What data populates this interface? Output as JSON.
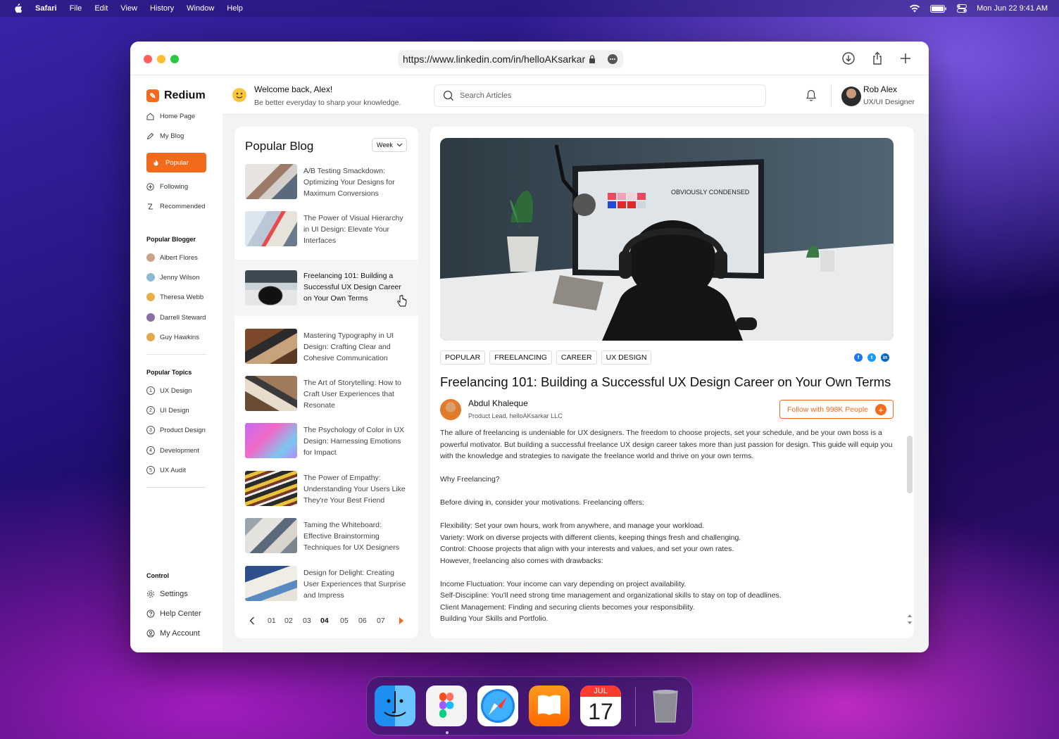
{
  "menubar": {
    "items": [
      "Safari",
      "File",
      "Edit",
      "View",
      "History",
      "Window",
      "Help"
    ],
    "datetime": "Mon Jun 22  9:41 AM"
  },
  "browser": {
    "url": "https://www.linkedin.com/in/helloAKsarkar"
  },
  "app": {
    "name": "Redium",
    "accent": "#f26b1d"
  },
  "sidebar": {
    "nav": [
      {
        "label": "Home Page",
        "icon": "home-icon"
      },
      {
        "label": "My Blog",
        "icon": "pen-icon"
      },
      {
        "label": "Popular",
        "icon": "fire-icon",
        "active": true
      },
      {
        "label": "Following",
        "icon": "plus-circle-icon"
      },
      {
        "label": "Recommended",
        "icon": "recommend-icon"
      }
    ],
    "bloggers_title": "Popular Blogger",
    "bloggers": [
      "Albert Flores",
      "Jenny Wilson",
      "Theresa Webb",
      "Darrell Steward",
      "Guy Hawkins"
    ],
    "topics_title": "Popular Topics",
    "topics": [
      {
        "num": "1",
        "label": "UX Design"
      },
      {
        "num": "2",
        "label": "UI Design"
      },
      {
        "num": "3",
        "label": "Product Design"
      },
      {
        "num": "4",
        "label": "Development"
      },
      {
        "num": "5",
        "label": "UX Audit"
      }
    ],
    "control_title": "Control",
    "control": [
      {
        "label": "Settings",
        "icon": "gear-icon"
      },
      {
        "label": "Help Center",
        "icon": "help-icon"
      },
      {
        "label": "My Account",
        "icon": "account-icon"
      }
    ]
  },
  "header": {
    "welcome": "Welcome back, Alex!",
    "subtitle": "Be better everyday to sharp your knowledge.",
    "search_placeholder": "Search Articles",
    "user_name": "Rob Alex",
    "user_role": "UX/UI Designer"
  },
  "popular": {
    "title": "Popular Blog",
    "filter": "Week",
    "items": [
      "A/B Testing Smackdown: Optimizing Your Designs for Maximum Conversions",
      "The Power of Visual Hierarchy in UI Design: Elevate Your Interfaces",
      "Freelancing 101: Building a Successful UX Design Career on Your Own Terms",
      "Mastering Typography in UI Design: Crafting Clear and Cohesive Communication",
      "The Art of Storytelling: How to Craft User Experiences that Resonate",
      "The Psychology of Color in UX Design: Harnessing Emotions for Impact",
      "The Power of Empathy: Understanding Your Users Like They're Your Best Friend",
      "Taming the Whiteboard: Effective Brainstorming Techniques for UX Designers",
      "Design for Delight: Creating User Experiences that Surprise and Impress"
    ],
    "selected_index": 2,
    "pages": [
      "01",
      "02",
      "03",
      "04",
      "05",
      "06",
      "07"
    ],
    "current_page": "04"
  },
  "article": {
    "hero_text": "OBVIOUSLY CONDENSED",
    "tags": [
      "POPULAR",
      "FREELANCING",
      "CAREER",
      "UX DESIGN"
    ],
    "social": [
      {
        "icon": "facebook-icon",
        "glyph": "f",
        "color": "#1877f2"
      },
      {
        "icon": "twitter-icon",
        "glyph": "t",
        "color": "#1d9bf0"
      },
      {
        "icon": "linkedin-icon",
        "glyph": "in",
        "color": "#0a66c2"
      }
    ],
    "title": "Freelancing 101: Building a Successful UX Design Career on Your Own Terms",
    "author_name": "Abdul Khaleque",
    "author_role": "Product Lead, helloAKsarkar LLC",
    "follow_label": "Follow with 998K People",
    "paragraphs": [
      "The allure of freelancing is undeniable for UX designers. The freedom to choose projects, set your schedule, and be your own boss is a powerful motivator. But building a successful freelance UX design career takes more than just passion for design. This guide will equip you with the knowledge and strategies to navigate the freelance world and thrive on your own terms.",
      "",
      "Why Freelancing?",
      "",
      "Before diving in, consider your motivations. Freelancing offers:",
      "",
      "Flexibility: Set your own hours, work from anywhere, and manage your workload.",
      "Variety: Work on diverse projects with different clients, keeping things fresh and challenging.",
      "Control: Choose projects that align with your interests and values, and set your own rates.",
      "However, freelancing also comes with drawbacks:",
      "",
      "Income Fluctuation: Your income can vary depending on project availability.",
      "Self-Discipline: You'll need strong time management and organizational skills to stay on top of deadlines.",
      "Client Management: Finding and securing clients becomes your responsibility.",
      "Building Your Skills and Portfolio."
    ]
  },
  "dock": {
    "calendar_month": "JUL",
    "calendar_day": "17",
    "apps": [
      "finder-icon",
      "figma-icon",
      "safari-icon",
      "books-icon",
      "calendar-icon",
      "trash-icon"
    ]
  }
}
